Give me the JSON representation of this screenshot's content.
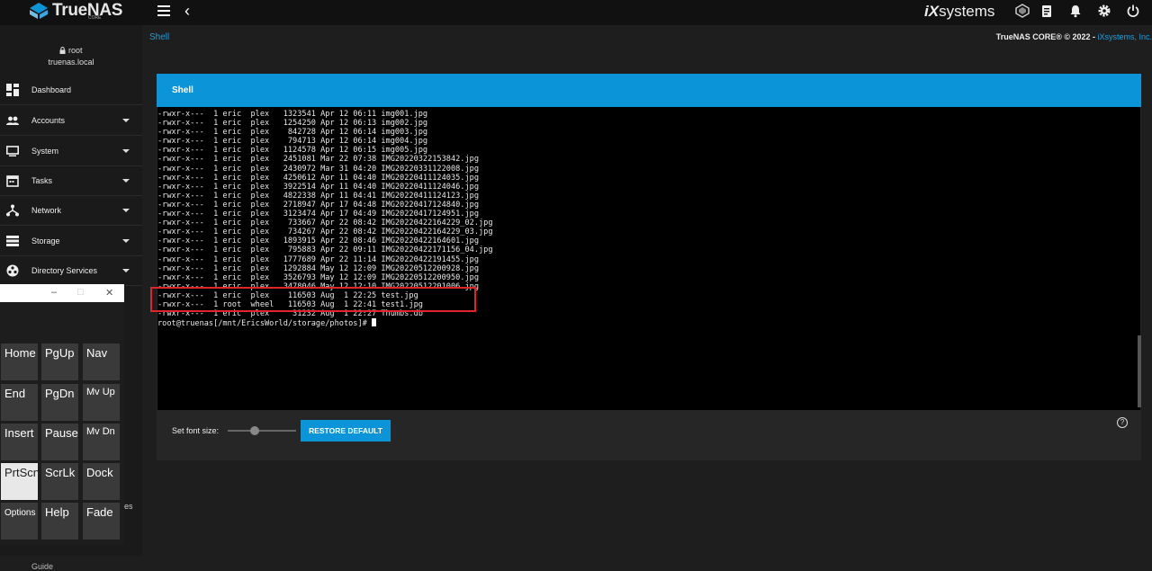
{
  "topbar": {
    "logo_text": "TrueNAS",
    "logo_sub": "CORE",
    "brand": "iXsystems",
    "icons": [
      "truecommand-icon",
      "clipboard-icon",
      "bell-icon",
      "gear-icon",
      "power-icon"
    ]
  },
  "sidebar": {
    "user_name": "root",
    "host": "truenas.local",
    "items": [
      {
        "label": "Dashboard",
        "icon": "dashboard-icon"
      },
      {
        "label": "Accounts",
        "icon": "accounts-icon"
      },
      {
        "label": "System",
        "icon": "system-icon"
      },
      {
        "label": "Tasks",
        "icon": "tasks-icon"
      },
      {
        "label": "Network",
        "icon": "network-icon"
      },
      {
        "label": "Storage",
        "icon": "storage-icon"
      },
      {
        "label": "Directory Services",
        "icon": "directory-icon"
      }
    ],
    "partial_es": "es",
    "guide": "Guide"
  },
  "page": {
    "breadcrumb": "Shell",
    "copyright": "TrueNAS CORE® © 2022 - ",
    "copyright_link": "iXsystems, Inc."
  },
  "shell": {
    "title": "Shell",
    "lines": [
      "-rwxr-x---  1 eric  plex   1323541 Apr 12 06:11 img001.jpg",
      "-rwxr-x---  1 eric  plex   1254250 Apr 12 06:13 img002.jpg",
      "-rwxr-x---  1 eric  plex    842728 Apr 12 06:14 img003.jpg",
      "-rwxr-x---  1 eric  plex    794713 Apr 12 06:14 img004.jpg",
      "-rwxr-x---  1 eric  plex   1124578 Apr 12 06:15 img005.jpg",
      "-rwxr-x---  1 eric  plex   2451081 Mar 22 07:38 IMG20220322153842.jpg",
      "-rwxr-x---  1 eric  plex   2430972 Mar 31 04:20 IMG20220331122008.jpg",
      "-rwxr-x---  1 eric  plex   4250612 Apr 11 04:40 IMG20220411124035.jpg",
      "-rwxr-x---  1 eric  plex   3922514 Apr 11 04:40 IMG20220411124046.jpg",
      "-rwxr-x---  1 eric  plex   4822338 Apr 11 04:41 IMG20220411124123.jpg",
      "-rwxr-x---  1 eric  plex   2718947 Apr 17 04:48 IMG20220417124840.jpg",
      "-rwxr-x---  1 eric  plex   3123474 Apr 17 04:49 IMG20220417124951.jpg",
      "-rwxr-x---  1 eric  plex    733667 Apr 22 08:42 IMG20220422164229_02.jpg",
      "-rwxr-x---  1 eric  plex    734267 Apr 22 08:42 IMG20220422164229_03.jpg",
      "-rwxr-x---  1 eric  plex   1893915 Apr 22 08:46 IMG20220422164601.jpg",
      "-rwxr-x---  1 eric  plex    795883 Apr 22 09:11 IMG20220422171156_04.jpg",
      "-rwxr-x---  1 eric  plex   1777689 Apr 22 11:14 IMG20220422191455.jpg",
      "-rwxr-x---  1 eric  plex   1292884 May 12 12:09 IMG20220512200928.jpg",
      "-rwxr-x---  1 eric  plex   3526793 May 12 12:09 IMG20220512200950.jpg",
      "-rwxr-x---  1 eric  plex   3478046 May 12 12:10 IMG20220512201006.jpg",
      "-rwxr-x---  1 eric  plex    116503 Aug  1 22:25 test.jpg",
      "-rwxr-x---  1 root  wheel   116503 Aug  1 22:41 test1.jpg",
      "-rwxr-x---  1 eric  plex     31232 Aug  1 22:27 Thumbs.db"
    ],
    "prompt": "root@truenas[/mnt/EricsWorld/storage/photos]# "
  },
  "controls": {
    "font_size_label": "Set font size:",
    "font_size_level": 0.4,
    "restore_label": "RESTORE DEFAULT",
    "help": "?"
  },
  "osk": {
    "minimize": "–",
    "maximize": "□",
    "close": "✕",
    "keys": [
      [
        "Home",
        "PgUp",
        "Nav"
      ],
      [
        "End",
        "PgDn",
        "Mv Up"
      ],
      [
        "Insert",
        "Pause",
        "Mv Dn"
      ],
      [
        "PrtScn",
        "ScrLk",
        "Dock"
      ],
      [
        "Options",
        "Help",
        "Fade"
      ]
    ]
  }
}
